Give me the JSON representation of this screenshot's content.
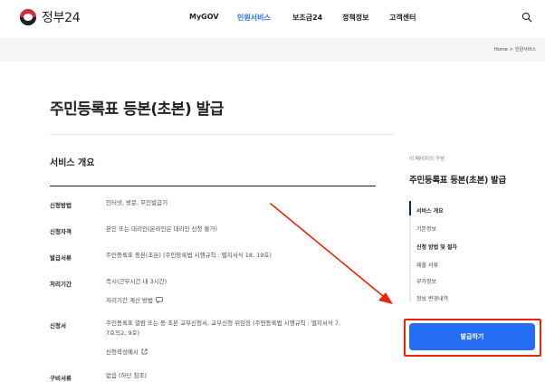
{
  "header": {
    "logo_text": "정부24",
    "nav": [
      {
        "label": "MyGOV",
        "active": false
      },
      {
        "label": "민원서비스",
        "active": true
      },
      {
        "label": "보조금24",
        "active": false
      },
      {
        "label": "정책정보",
        "active": false
      },
      {
        "label": "고객센터",
        "active": false
      }
    ]
  },
  "breadcrumb": {
    "home": "Home",
    "separator": ">",
    "current": "민원서비스"
  },
  "page": {
    "title": "주민등록표 등본(초본) 발급"
  },
  "service": {
    "section_title": "서비스 개요",
    "rows": [
      {
        "label": "신청방법",
        "value": "인터넷, 방문, 무인발급기"
      },
      {
        "label": "신청자격",
        "value": "본인 또는 대리인(온라인은 대리인 신청 불가)"
      },
      {
        "label": "발급서류",
        "value": "주민등록표 등본(초본) (주민등록법 시행규칙 : 별지서식 18, 19호)"
      },
      {
        "label": "처리기간",
        "value": "즉시(근무시간 내 3시간)",
        "link": "처리기간 계산 방법"
      },
      {
        "label": "신청서",
        "value_line1": "주민등록표 열람 또는 등·초본 교부신청서, 교부신청 위임장 (주민등록법 시행규칙 : 별지서식 7,",
        "value_line2": "7호의2, 9호)",
        "link": "신청작성예시"
      },
      {
        "label": "구비서류",
        "value": "없음 (하단 참조)"
      }
    ]
  },
  "toc": {
    "caption": "이 페이지의 구성",
    "title": "주민등록표 등본(초본) 발급",
    "items": [
      {
        "label": "서비스 개요",
        "strong": true
      },
      {
        "label": "기본정보",
        "strong": false
      },
      {
        "label": "신청 방법 및 절차",
        "strong": true
      },
      {
        "label": "제출 서류",
        "strong": false
      },
      {
        "label": "부가정보",
        "strong": false
      },
      {
        "label": "정보 변경내역",
        "strong": false
      }
    ]
  },
  "issue_button": {
    "label": "발급하기"
  },
  "colors": {
    "accent": "#256ef4",
    "annotation": "#e8250c",
    "toc_active": "#052b57"
  }
}
